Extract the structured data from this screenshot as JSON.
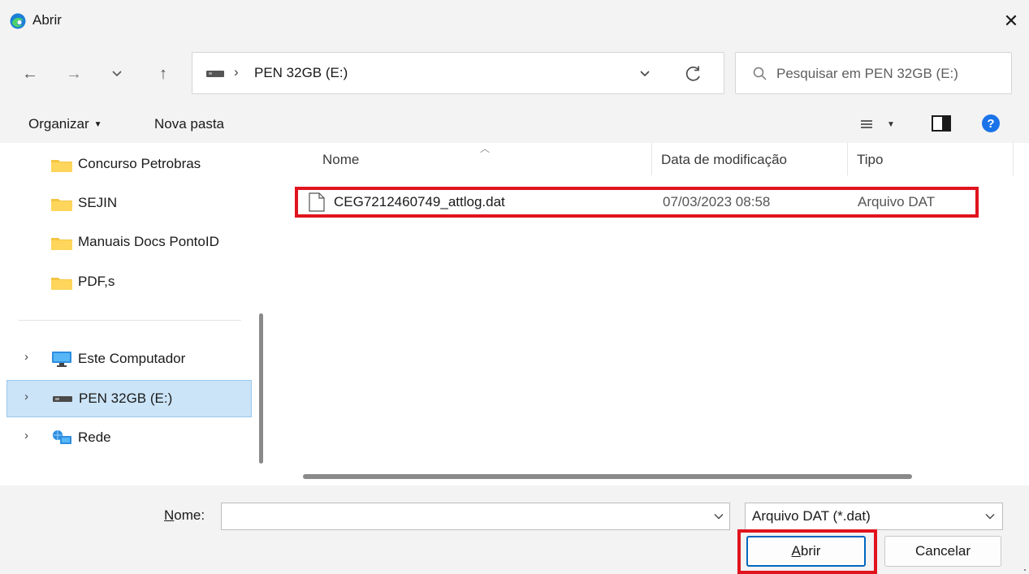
{
  "window": {
    "title": "Abrir",
    "close_glyph": "✕",
    "app_icon": "edge-browser-icon"
  },
  "nav": {
    "back_glyph": "←",
    "forward_glyph": "→",
    "recent_glyph": "⌄",
    "up_glyph": "↑"
  },
  "address": {
    "separator": "›",
    "location": "PEN 32GB (E:)",
    "drive_icon": "usb-drive-icon"
  },
  "search": {
    "placeholder": "Pesquisar em PEN 32GB (E:)"
  },
  "toolbar": {
    "organizar_label": "Organizar",
    "caret": "▼",
    "nova_pasta_label": "Nova pasta"
  },
  "sidebar": {
    "items": [
      {
        "label": "Concurso Petrobras",
        "icon": "folder-icon"
      },
      {
        "label": "SEJIN",
        "icon": "folder-icon"
      },
      {
        "label": "Manuais Docs PontoID",
        "icon": "folder-icon"
      },
      {
        "label": "PDF,s",
        "icon": "folder-icon"
      }
    ],
    "locations": [
      {
        "label": "Este Computador",
        "icon": "computer-icon",
        "selected": false
      },
      {
        "label": "PEN 32GB (E:)",
        "icon": "usb-drive-icon",
        "selected": true
      },
      {
        "label": "Rede",
        "icon": "network-icon",
        "selected": false
      }
    ],
    "expand_glyph": "›"
  },
  "file_list": {
    "columns": {
      "name": "Nome",
      "date": "Data de modificação",
      "type": "Tipo"
    },
    "sort_glyph": "︿",
    "rows": [
      {
        "name": "CEG7212460749_attlog.dat",
        "date": "07/03/2023 08:58",
        "type": "Arquivo DAT",
        "highlighted": true
      }
    ]
  },
  "bottom": {
    "name_label_accel": "N",
    "name_label_rest": "ome:",
    "name_value": "",
    "file_type": "Arquivo DAT (*.dat)",
    "open_accel": "A",
    "open_rest": "brir",
    "cancel_label": "Cancelar"
  },
  "colors": {
    "highlight_box": "#e0141e",
    "selection_bg": "#cce4f7",
    "accent": "#0067c0",
    "chrome_bg": "#f3f3f3"
  }
}
